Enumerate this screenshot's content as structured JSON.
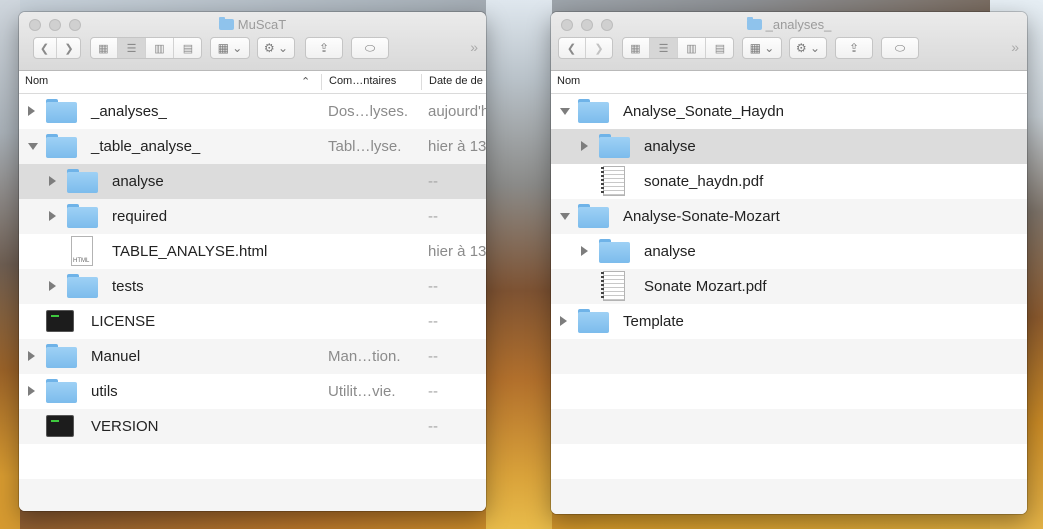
{
  "left_window": {
    "title": "MuScaT",
    "columns": {
      "name": "Nom",
      "comment": "Com…ntaires",
      "date": "Date de de"
    },
    "rows": [
      {
        "name": "_analyses_",
        "comment": "Dos…lyses.",
        "date": "aujourd'h",
        "type": "folder",
        "disclosure": "closed"
      },
      {
        "name": "_table_analyse_",
        "comment": "Tabl…lyse.",
        "date": "hier à 13",
        "type": "folder",
        "disclosure": "open"
      },
      {
        "name": "analyse",
        "comment": "",
        "date": "--",
        "type": "folder",
        "disclosure": "closed"
      },
      {
        "name": "required",
        "comment": "",
        "date": "--",
        "type": "folder",
        "disclosure": "closed"
      },
      {
        "name": "TABLE_ANALYSE.html",
        "comment": "",
        "date": "hier à 13",
        "type": "html"
      },
      {
        "name": "tests",
        "comment": "",
        "date": "--",
        "type": "folder",
        "disclosure": "closed"
      },
      {
        "name": "LICENSE",
        "comment": "",
        "date": "--",
        "type": "terminal"
      },
      {
        "name": "Manuel",
        "comment": "Man…tion.",
        "date": "--",
        "type": "folder",
        "disclosure": "closed"
      },
      {
        "name": "utils",
        "comment": "Utilit…vie.",
        "date": "--",
        "type": "folder",
        "disclosure": "closed"
      },
      {
        "name": "VERSION",
        "comment": "",
        "date": "--",
        "type": "terminal"
      }
    ]
  },
  "right_window": {
    "title": "_analyses_",
    "columns": {
      "name": "Nom"
    },
    "rows": [
      {
        "name": "Analyse_Sonate_Haydn",
        "type": "folder",
        "disclosure": "open"
      },
      {
        "name": "analyse",
        "type": "folder",
        "disclosure": "closed"
      },
      {
        "name": "sonate_haydn.pdf",
        "type": "pdf"
      },
      {
        "name": "Analyse-Sonate-Mozart",
        "type": "folder",
        "disclosure": "open"
      },
      {
        "name": "analyse",
        "type": "folder",
        "disclosure": "closed"
      },
      {
        "name": "Sonate Mozart.pdf",
        "type": "pdf"
      },
      {
        "name": "Template",
        "type": "folder",
        "disclosure": "closed"
      }
    ]
  },
  "toolbar": {
    "back_glyph": "❮",
    "forward_glyph": "❯",
    "overflow_glyph": "»",
    "view_modes": [
      "icon-view",
      "list-view",
      "column-view",
      "gallery-view"
    ],
    "selected_view": "list-view"
  },
  "colors": {
    "folder": "#8fc7f0",
    "selected_row": "#dcdcdc",
    "alt_row": "#f5f5f5"
  }
}
